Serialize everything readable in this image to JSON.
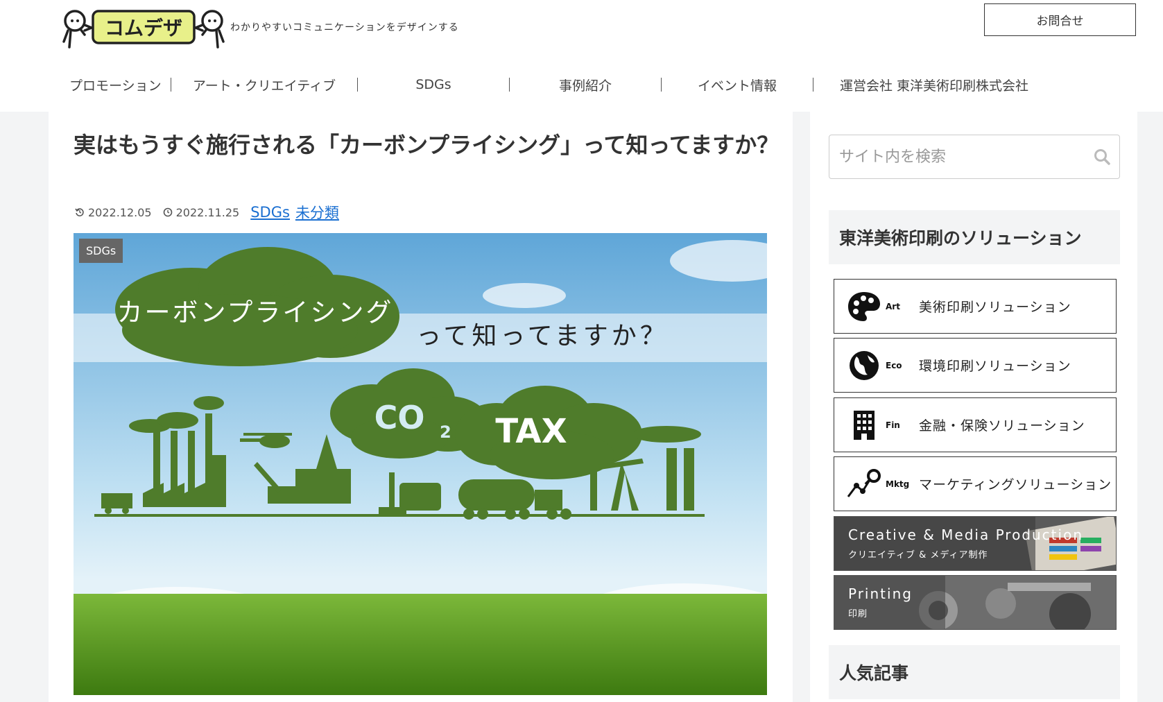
{
  "header": {
    "logo_text": "コムデザ",
    "tagline": "わかりやすいコミュニケーションをデザインする",
    "contact_label": "お問合せ"
  },
  "nav": {
    "items": [
      {
        "label": "プロモーション"
      },
      {
        "label": "アート・クリエイティブ"
      },
      {
        "label": "SDGs"
      },
      {
        "label": "事例紹介"
      },
      {
        "label": "イベント情報"
      },
      {
        "label": "運営会社 東洋美術印刷株式会社"
      }
    ]
  },
  "article": {
    "title": "実はもうすぐ施行される「カーボンプライシング」って知ってますか？",
    "updated_date": "2022.12.05",
    "published_date": "2022.11.25",
    "categories": [
      "SDGs",
      "未分類"
    ],
    "eyecatch": {
      "category_label": "SDGs",
      "headline": "カーボンプライシング",
      "headline_suffix": "って知ってますか？",
      "co2": "CO",
      "co2_sub": "2",
      "tax": "TAX",
      "colors": {
        "cloud_green": "#4f7c2b",
        "sky": "#7fbde2",
        "grass": "#5a9a1e"
      }
    }
  },
  "sidebar": {
    "search_placeholder": "サイト内を検索",
    "solutions_title": "東洋美術印刷のソリューション",
    "solutions": [
      {
        "abbr": "Art",
        "label": "美術印刷ソリューション",
        "icon": "palette-icon"
      },
      {
        "abbr": "Eco",
        "label": "環境印刷ソリューション",
        "icon": "globe-icon"
      },
      {
        "abbr": "Fin",
        "label": "金融・保険ソリューション",
        "icon": "building-icon"
      },
      {
        "abbr": "Mktg",
        "label": "マーケティングソリューション",
        "icon": "chart-search-icon"
      }
    ],
    "banners": [
      {
        "title": "Creative & Media Production",
        "subtitle": "クリエイティブ & メディア制作"
      },
      {
        "title": "Printing",
        "subtitle": "印刷"
      }
    ],
    "popular_title": "人気記事"
  }
}
